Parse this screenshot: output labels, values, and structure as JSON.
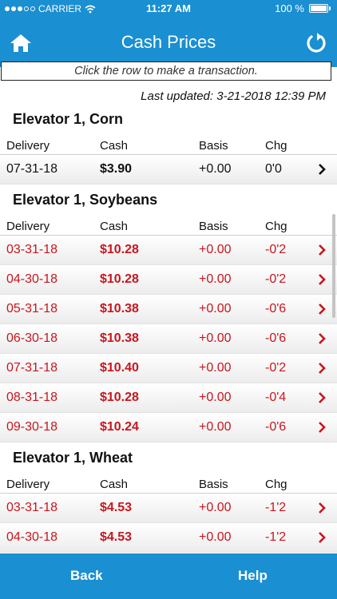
{
  "status_bar": {
    "carrier": "CARRIER",
    "time": "11:27 AM",
    "battery": "100 %"
  },
  "header": {
    "title": "Cash Prices"
  },
  "instruction": "Click the row to make a transaction.",
  "last_updated": "Last updated: 3-21-2018 12:39 PM",
  "columns": {
    "delivery": "Delivery",
    "cash": "Cash",
    "basis": "Basis",
    "chg": "Chg"
  },
  "sections": [
    {
      "title": "Elevator 1, Corn",
      "rows": [
        {
          "delivery": "07-31-18",
          "cash": "$3.90",
          "basis": "+0.00",
          "chg": "0'0",
          "color": "black"
        }
      ]
    },
    {
      "title": "Elevator 1, Soybeans",
      "rows": [
        {
          "delivery": "03-31-18",
          "cash": "$10.28",
          "basis": "+0.00",
          "chg": "-0'2",
          "color": "red"
        },
        {
          "delivery": "04-30-18",
          "cash": "$10.28",
          "basis": "+0.00",
          "chg": "-0'2",
          "color": "red"
        },
        {
          "delivery": "05-31-18",
          "cash": "$10.38",
          "basis": "+0.00",
          "chg": "-0'6",
          "color": "red"
        },
        {
          "delivery": "06-30-18",
          "cash": "$10.38",
          "basis": "+0.00",
          "chg": "-0'6",
          "color": "red"
        },
        {
          "delivery": "07-31-18",
          "cash": "$10.40",
          "basis": "+0.00",
          "chg": "-0'2",
          "color": "red"
        },
        {
          "delivery": "08-31-18",
          "cash": "$10.28",
          "basis": "+0.00",
          "chg": "-0'4",
          "color": "red"
        },
        {
          "delivery": "09-30-18",
          "cash": "$10.24",
          "basis": "+0.00",
          "chg": "-0'6",
          "color": "red"
        }
      ]
    },
    {
      "title": "Elevator 1, Wheat",
      "rows": [
        {
          "delivery": "03-31-18",
          "cash": "$4.53",
          "basis": "+0.00",
          "chg": "-1'2",
          "color": "red"
        },
        {
          "delivery": "04-30-18",
          "cash": "$4.53",
          "basis": "+0.00",
          "chg": "-1'2",
          "color": "red"
        }
      ]
    }
  ],
  "toolbar": {
    "back_label": "Back",
    "help_label": "Help"
  },
  "icons": {
    "home": "home-icon",
    "refresh": "refresh-icon",
    "row_arrow": "chevron-right-icon"
  },
  "colors": {
    "brand": "#1a8fd1",
    "down": "#c8161d",
    "neutral": "#111111"
  }
}
